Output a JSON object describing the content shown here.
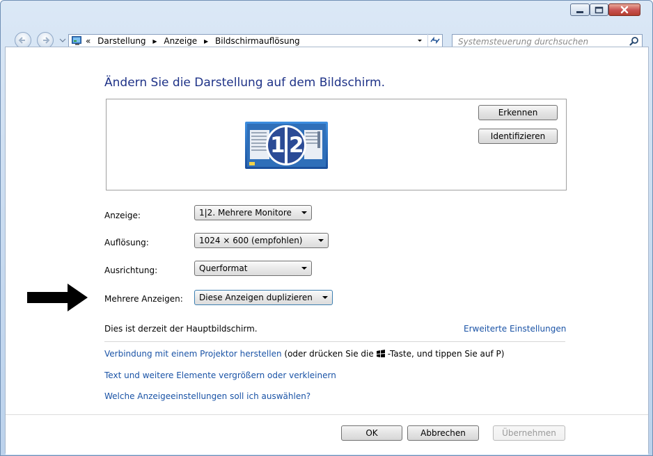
{
  "window": {
    "buttons": {
      "minimize": "minimize-icon",
      "maximize": "maximize-icon",
      "close": "close-icon"
    }
  },
  "nav": {
    "breadcrumbs": [
      "Darstellung",
      "Anzeige",
      "Bildschirmauflösung"
    ],
    "overflow": "«",
    "search_placeholder": "Systemsteuerung durchsuchen"
  },
  "main": {
    "heading": "Ändern Sie die Darstellung auf dem Bildschirm.",
    "detect_label": "Erkennen",
    "identify_label": "Identifizieren",
    "monitor_numbers": [
      "1",
      "2"
    ],
    "fields": [
      {
        "label": "Anzeige:",
        "value": "1|2. Mehrere Monitore"
      },
      {
        "label": "Auflösung:",
        "value": "1024 × 600 (empfohlen)"
      },
      {
        "label": "Ausrichtung:",
        "value": "Querformat"
      },
      {
        "label": "Mehrere Anzeigen:",
        "value": "Diese Anzeigen duplizieren"
      }
    ],
    "status_note": "Dies ist derzeit der Hauptbildschirm.",
    "advanced_link": "Erweiterte Einstellungen",
    "projector_link": "Verbindung mit einem Projektor herstellen",
    "projector_hint_before": "(oder drücken Sie die",
    "projector_hint_after": "-Taste, und tippen Sie auf P)",
    "text_size_link": "Text und weitere Elemente vergrößern oder verkleinern",
    "which_settings_link": "Welche Anzeigeeinstellungen soll ich auswählen?"
  },
  "footer": {
    "ok_label": "OK",
    "cancel_label": "Abbrechen",
    "apply_label": "Übernehmen"
  },
  "colors": {
    "link": "#1a53a6",
    "heading": "#1e3287",
    "chrome": "#c6d9ef"
  }
}
